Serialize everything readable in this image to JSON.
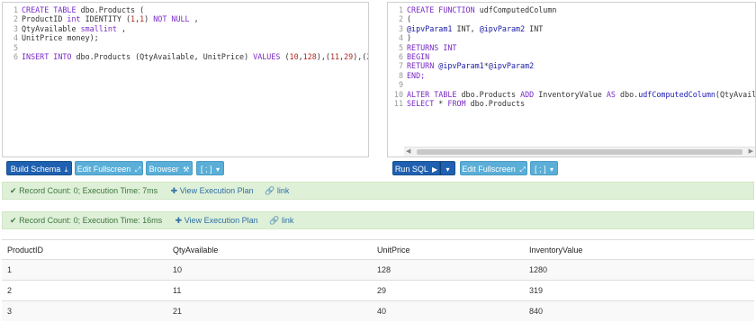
{
  "schema_editor": {
    "lines": [
      {
        "n": "1",
        "tokens": [
          {
            "t": "CREATE TABLE ",
            "c": "kw"
          },
          {
            "t": "dbo.Products (",
            "c": ""
          }
        ]
      },
      {
        "n": "2",
        "tokens": [
          {
            "t": "ProductID ",
            "c": ""
          },
          {
            "t": "int",
            "c": "kw"
          },
          {
            "t": " IDENTITY (",
            "c": ""
          },
          {
            "t": "1",
            "c": "num"
          },
          {
            "t": ",",
            "c": ""
          },
          {
            "t": "1",
            "c": "num"
          },
          {
            "t": ") ",
            "c": ""
          },
          {
            "t": "NOT NULL",
            "c": "kw"
          },
          {
            "t": " ,",
            "c": ""
          }
        ]
      },
      {
        "n": "3",
        "tokens": [
          {
            "t": "QtyAvailable ",
            "c": ""
          },
          {
            "t": "smallint",
            "c": "kw"
          },
          {
            "t": " ,",
            "c": ""
          }
        ]
      },
      {
        "n": "4",
        "tokens": [
          {
            "t": "UnitPrice money);",
            "c": ""
          }
        ]
      },
      {
        "n": "5",
        "tokens": []
      },
      {
        "n": "6",
        "tokens": [
          {
            "t": "INSERT INTO ",
            "c": "kw"
          },
          {
            "t": "dbo.Products (QtyAvailable, UnitPrice) ",
            "c": ""
          },
          {
            "t": "VALUES",
            "c": "kw"
          },
          {
            "t": " (",
            "c": ""
          },
          {
            "t": "10",
            "c": "num"
          },
          {
            "t": ",",
            "c": ""
          },
          {
            "t": "128",
            "c": "num"
          },
          {
            "t": "),(",
            "c": ""
          },
          {
            "t": "11",
            "c": "num"
          },
          {
            "t": ",",
            "c": ""
          },
          {
            "t": "29",
            "c": "num"
          },
          {
            "t": "),(",
            "c": ""
          },
          {
            "t": "21",
            "c": "num"
          },
          {
            "t": ",",
            "c": ""
          },
          {
            "t": "40",
            "c": "num"
          },
          {
            "t": ");",
            "c": ""
          }
        ]
      }
    ]
  },
  "query_editor": {
    "lines": [
      {
        "n": "1",
        "tokens": [
          {
            "t": "CREATE FUNCTION ",
            "c": "kw"
          },
          {
            "t": "udfComputedColumn",
            "c": ""
          }
        ]
      },
      {
        "n": "2",
        "tokens": [
          {
            "t": "(",
            "c": ""
          }
        ]
      },
      {
        "n": "3",
        "tokens": [
          {
            "t": "@ipvParam1",
            "c": "var"
          },
          {
            "t": " INT, ",
            "c": ""
          },
          {
            "t": "@ipvParam2",
            "c": "var"
          },
          {
            "t": " INT",
            "c": ""
          }
        ]
      },
      {
        "n": "4",
        "tokens": [
          {
            "t": ")",
            "c": ""
          }
        ]
      },
      {
        "n": "5",
        "tokens": [
          {
            "t": "RETURNS INT",
            "c": "kw"
          }
        ]
      },
      {
        "n": "6",
        "tokens": [
          {
            "t": "BEGIN",
            "c": "kw"
          }
        ]
      },
      {
        "n": "7",
        "tokens": [
          {
            "t": "RETURN ",
            "c": "kw"
          },
          {
            "t": "@ipvParam1",
            "c": "var"
          },
          {
            "t": "*",
            "c": ""
          },
          {
            "t": "@ipvParam2",
            "c": "var"
          }
        ]
      },
      {
        "n": "8",
        "tokens": [
          {
            "t": "END;",
            "c": "kw"
          }
        ]
      },
      {
        "n": "9",
        "tokens": []
      },
      {
        "n": "10",
        "tokens": [
          {
            "t": "ALTER TABLE ",
            "c": "kw"
          },
          {
            "t": "dbo.Products ",
            "c": ""
          },
          {
            "t": "ADD ",
            "c": "kw"
          },
          {
            "t": "InventoryValue ",
            "c": ""
          },
          {
            "t": "AS ",
            "c": "kw"
          },
          {
            "t": "dbo.",
            "c": ""
          },
          {
            "t": "udfComputedColumn",
            "c": "def"
          },
          {
            "t": "(QtyAvailable,UnitPri",
            "c": ""
          }
        ]
      },
      {
        "n": "11",
        "tokens": [
          {
            "t": "SELECT",
            "c": "kw"
          },
          {
            "t": " * ",
            "c": ""
          },
          {
            "t": "FROM",
            "c": "kw"
          },
          {
            "t": " dbo.Products",
            "c": ""
          }
        ]
      }
    ]
  },
  "buttons": {
    "build_schema": "Build Schema",
    "edit_fullscreen": "Edit Fullscreen",
    "browser": "Browser",
    "delimiter": "[ ; ]",
    "run_sql": "Run SQL",
    "edit_fullscreen_2": "Edit Fullscreen",
    "delimiter_2": "[ ; ]"
  },
  "schema_result": {
    "status": "Record Count: 0; Execution Time: 7ms",
    "view_plan": "View Execution Plan",
    "link": "link"
  },
  "query_result": {
    "status": "Record Count: 0; Execution Time: 16ms",
    "view_plan": "View Execution Plan",
    "link": "link"
  },
  "results_table": {
    "columns": [
      "ProductID",
      "QtyAvailable",
      "UnitPrice",
      "InventoryValue"
    ],
    "rows": [
      [
        "1",
        "10",
        "128",
        "1280"
      ],
      [
        "2",
        "11",
        "29",
        "319"
      ],
      [
        "3",
        "21",
        "40",
        "840"
      ]
    ]
  },
  "icons": {
    "download": "download-icon",
    "expand": "expand-icon",
    "browser": "browser-icon",
    "caret": "caret-down-icon",
    "play": "play-icon",
    "check": "check-icon",
    "plus": "plus-icon",
    "link": "link-icon"
  }
}
